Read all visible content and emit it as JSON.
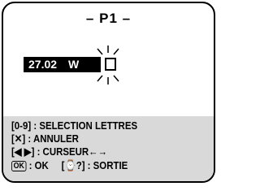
{
  "screen": {
    "title": "– P1 –",
    "entry": {
      "date": "27.02",
      "letter": "W"
    }
  },
  "help": {
    "line1": "[0-9] : SELECTION LETTRES",
    "line2": "[✕] : ANNULER",
    "line3": "[◀ ▶] : CURSEUR←→",
    "ok_key": "OK",
    "ok_text": " : OK",
    "exit_text": "[⌚?] : SORTIE"
  }
}
